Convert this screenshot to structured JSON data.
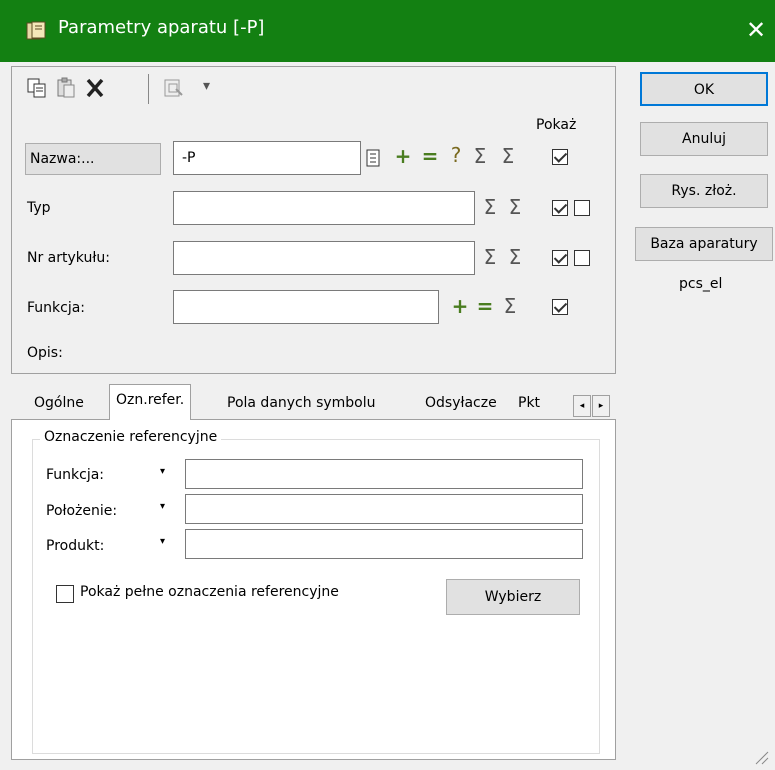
{
  "window": {
    "title": "Parametry aparatu [-P]",
    "close_glyph": "✕"
  },
  "toolbar": {
    "icons": [
      "copy-icon",
      "paste-icon",
      "delete-icon",
      "component-icon",
      "dropdown-icon"
    ],
    "dropdown_glyph": "▾"
  },
  "fields": {
    "pokaz_label": "Pokaż",
    "nazwa": {
      "button_label": "Nazwa:...",
      "value": "-P"
    },
    "typ": {
      "label": "Typ",
      "value": ""
    },
    "nr_artykulu": {
      "label": "Nr artykułu:",
      "value": ""
    },
    "funkcja": {
      "label": "Funkcja:",
      "value": ""
    },
    "opis": {
      "label": "Opis:"
    }
  },
  "symbols": {
    "plus": "+",
    "equals": "=",
    "question": "?",
    "sigma": "Σ"
  },
  "side_buttons": {
    "ok": "OK",
    "anuluj": "Anuluj",
    "rys": "Rys. złoż.",
    "baza": "Baza aparatury",
    "database_name": "pcs_el"
  },
  "tabs": [
    {
      "label": "Ogólne"
    },
    {
      "label": "Ozn.refer."
    },
    {
      "label": "Pola danych symbolu"
    },
    {
      "label": "Odsyłacze"
    },
    {
      "label": "Pkt"
    }
  ],
  "tab_scroll": {
    "left": "◂",
    "right": "▸"
  },
  "ref_group": {
    "legend": "Oznaczenie referencyjne",
    "rows": [
      {
        "label": "Funkcja:",
        "value": ""
      },
      {
        "label": "Położenie:",
        "value": ""
      },
      {
        "label": "Produkt:",
        "value": ""
      }
    ],
    "dropdown_glyph": "▾",
    "show_full_label": "Pokaż pełne oznaczenia referencyjne",
    "wybierz_label": "Wybierz"
  }
}
